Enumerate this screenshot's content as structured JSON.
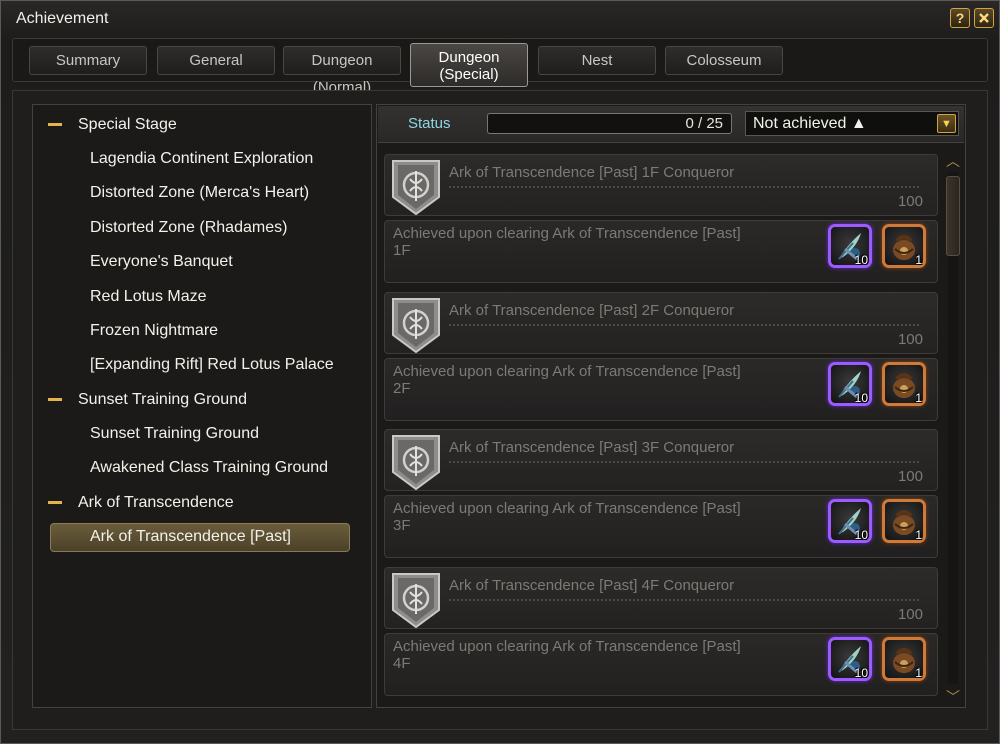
{
  "window": {
    "title": "Achievement",
    "help_label": "?",
    "close_label": "X"
  },
  "tabs": [
    {
      "label": "Summary"
    },
    {
      "label": "General"
    },
    {
      "label": "Dungeon (Normal)"
    },
    {
      "label": "Dungeon (Special)"
    },
    {
      "label": "Nest"
    },
    {
      "label": "Colosseum"
    }
  ],
  "active_tab": "Dungeon (Special)",
  "sidebar": {
    "groups": [
      {
        "label": "Special Stage",
        "items": [
          "Lagendia Continent Exploration",
          "Distorted Zone (Merca's Heart)",
          "Distorted Zone (Rhadames)",
          "Everyone's Banquet",
          "Red Lotus Maze",
          "Frozen Nightmare",
          "[Expanding Rift] Red Lotus Palace"
        ]
      },
      {
        "label": "Sunset Training Ground",
        "items": [
          "Sunset Training Ground",
          "Awakened Class Training Ground"
        ]
      },
      {
        "label": "Ark of Transcendence",
        "items": [
          "Ark of Transcendence [Past]"
        ]
      }
    ],
    "selected": "Ark of Transcendence [Past]"
  },
  "status": {
    "label": "Status",
    "progress_text": "0 / 25",
    "progress": 0,
    "filter": "Not achieved ▲"
  },
  "achievements": [
    {
      "title": "Ark of Transcendence [Past] 1F Conqueror",
      "points": "100",
      "desc_line1": "Achieved upon clearing Ark of Transcendence [Past]",
      "desc_line2": "1F",
      "rewards": [
        {
          "count": "10",
          "icon": "feather-quill-icon"
        },
        {
          "count": "1",
          "icon": "pouch-icon"
        }
      ]
    },
    {
      "title": "Ark of Transcendence [Past] 2F Conqueror",
      "points": "100",
      "desc_line1": "Achieved upon clearing Ark of Transcendence [Past]",
      "desc_line2": "2F",
      "rewards": [
        {
          "count": "10",
          "icon": "feather-quill-icon"
        },
        {
          "count": "1",
          "icon": "pouch-icon"
        }
      ]
    },
    {
      "title": "Ark of Transcendence [Past] 3F Conqueror",
      "points": "100",
      "desc_line1": "Achieved upon clearing Ark of Transcendence [Past]",
      "desc_line2": "3F",
      "rewards": [
        {
          "count": "10",
          "icon": "feather-quill-icon"
        },
        {
          "count": "1",
          "icon": "pouch-icon"
        }
      ]
    },
    {
      "title": "Ark of Transcendence [Past] 4F Conqueror",
      "points": "100",
      "desc_line1": "Achieved upon clearing Ark of Transcendence [Past]",
      "desc_line2": "4F",
      "rewards": [
        {
          "count": "10",
          "icon": "feather-quill-icon"
        },
        {
          "count": "1",
          "icon": "pouch-icon"
        }
      ]
    }
  ],
  "colors": {
    "accent_gold": "#d4a23e",
    "status_cyan": "#8fd6e6",
    "reward_purple": "#9b5bff",
    "reward_orange": "#d07a3a"
  }
}
